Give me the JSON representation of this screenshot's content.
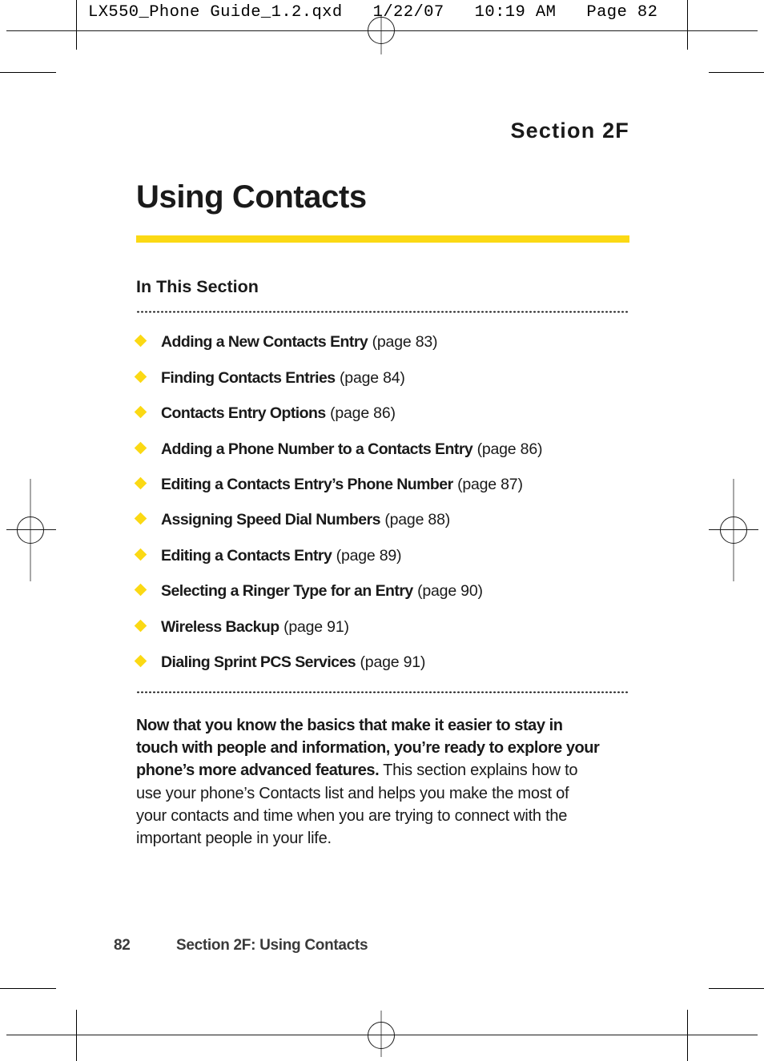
{
  "prepress": {
    "slug": "LX550_Phone Guide_1.2.qxd   1/22/07   10:19 AM   Page 82"
  },
  "section": {
    "label": "Section 2F",
    "title": "Using Contacts",
    "accent_color": "#fbd914"
  },
  "in_this_section": {
    "heading": "In This Section",
    "items": [
      {
        "label": "Adding a New Contacts Entry",
        "page": "(page 83)"
      },
      {
        "label": "Finding Contacts Entries",
        "page": "(page 84)"
      },
      {
        "label": "Contacts Entry Options",
        "page": "(page 86)"
      },
      {
        "label": "Adding a Phone Number to a Contacts Entry",
        "page": "(page 86)"
      },
      {
        "label": "Editing a Contacts Entry’s Phone Number",
        "page": "(page 87)"
      },
      {
        "label": "Assigning Speed Dial Numbers",
        "page": "(page 88)"
      },
      {
        "label": "Editing a Contacts Entry",
        "page": "(page 89)"
      },
      {
        "label": "Selecting a Ringer Type for an Entry",
        "page": "(page 90)"
      },
      {
        "label": "Wireless Backup",
        "page": "(page 91)"
      },
      {
        "label": "Dialing Sprint PCS Services",
        "page": "(page 91)"
      }
    ]
  },
  "intro": {
    "lead": "Now that you know the basics that make it easier to stay in touch with people and information, you’re ready to explore your phone’s more advanced features.",
    "rest": " This section explains how to use your phone’s Contacts list and helps you make the most of your contacts and time when you are trying to connect with the important people in your life."
  },
  "footer": {
    "folio": "82",
    "running_head": "Section 2F: Using Contacts"
  }
}
